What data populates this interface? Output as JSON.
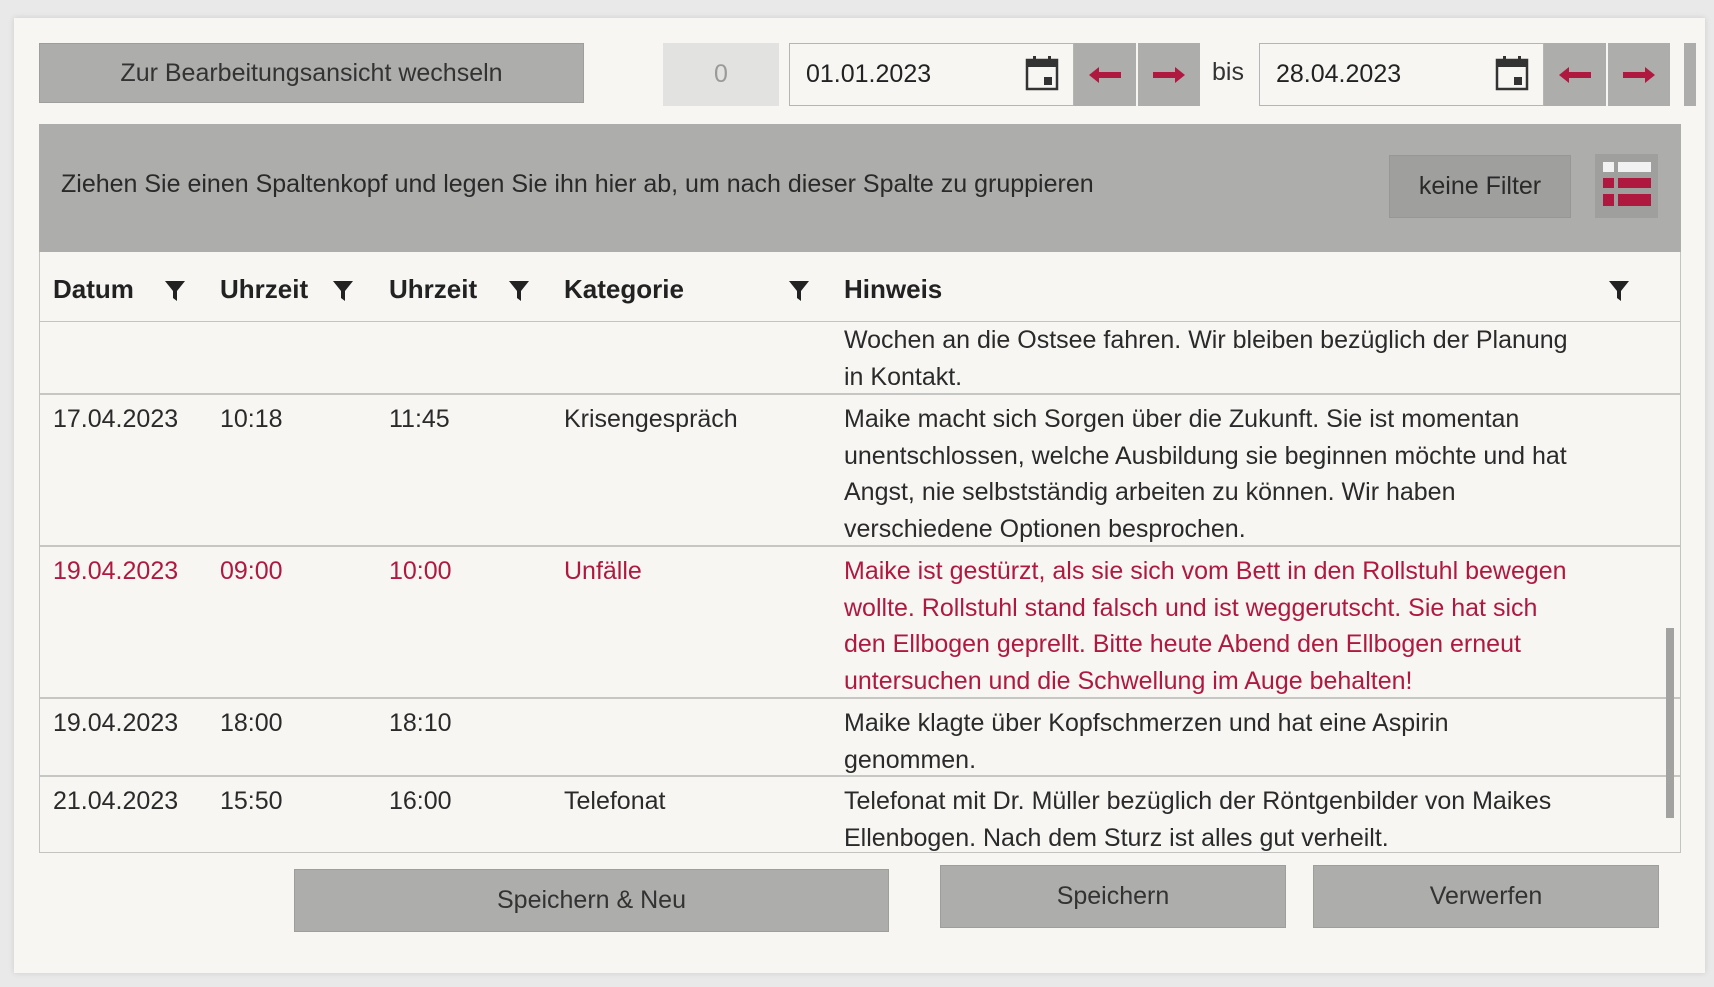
{
  "toolbar": {
    "switch_label": "Zur Bearbeitungsansicht wechseln",
    "count": "0",
    "date_from": "01.01.2023",
    "bis": "bis",
    "date_to": "28.04.2023"
  },
  "group_bar": {
    "hint": "Ziehen Sie einen Spaltenkopf und legen Sie ihn hier ab, um nach dieser Spalte zu gruppieren",
    "filter_label": "keine Filter"
  },
  "table": {
    "columns": [
      "Datum",
      "Uhrzeit",
      "Uhrzeit",
      "Kategorie",
      "Hinweis"
    ],
    "rows": [
      {
        "datum": "",
        "von": "",
        "bis": "",
        "kategorie": "",
        "hinweis": [
          "Wochen an die Ostsee fahren. Wir bleiben bezüglich der Planung",
          "in Kontakt."
        ]
      },
      {
        "datum": "17.04.2023",
        "von": "10:18",
        "bis": "11:45",
        "kategorie": "Krisengespräch",
        "hinweis": [
          "Maike macht sich Sorgen über die Zukunft. Sie ist momentan",
          "unentschlossen, welche Ausbildung sie beginnen möchte und hat",
          "Angst, nie selbstständig arbeiten zu können. Wir haben",
          "verschiedene Optionen besprochen."
        ]
      },
      {
        "datum": "19.04.2023",
        "von": "09:00",
        "bis": "10:00",
        "kategorie": "Unfälle",
        "hinweis": [
          "Maike ist gestürzt, als sie sich vom Bett in den Rollstuhl bewegen",
          "wollte. Rollstuhl stand falsch und ist weggerutscht. Sie hat sich",
          "den Ellbogen geprellt. Bitte heute Abend den Ellbogen erneut",
          "untersuchen und die Schwellung im Auge behalten!"
        ]
      },
      {
        "datum": "19.04.2023",
        "von": "18:00",
        "bis": "18:10",
        "kategorie": "",
        "hinweis": [
          "Maike klagte über Kopfschmerzen und hat eine Aspirin",
          "genommen."
        ]
      },
      {
        "datum": "21.04.2023",
        "von": "15:50",
        "bis": "16:00",
        "kategorie": "Telefonat",
        "hinweis": [
          "Telefonat mit Dr. Müller bezüglich der Röntgenbilder von Maikes",
          "Ellenbogen. Nach dem Sturz ist alles gut verheilt."
        ]
      }
    ]
  },
  "footer": {
    "save_new": "Speichern & Neu",
    "save": "Speichern",
    "discard": "Verwerfen"
  },
  "colors": {
    "accent": "#b0193f",
    "button_gray": "#adadab",
    "panel_bg": "#f7f6f3"
  },
  "icons": {
    "calendar": "calendar-icon",
    "prev": "arrow-left-icon",
    "next": "arrow-right-icon",
    "filter": "funnel-icon",
    "layout": "list-layout-icon"
  }
}
